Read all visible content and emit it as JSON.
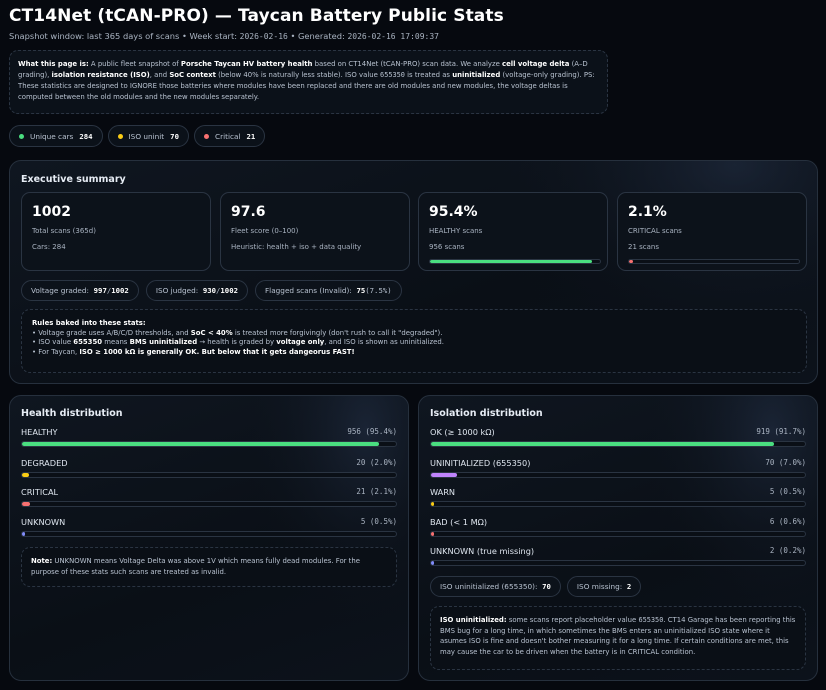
{
  "header": {
    "title": "CT14Net (tCAN-PRO) — Taycan Battery Public Stats",
    "snapshot_prefix": "Snapshot window: last 365 days of scans • Week start: ",
    "week_start": "2026-02-16",
    "generated_prefix": " • Generated: ",
    "generated": "2026-02-16 17:09:37"
  },
  "about": {
    "lead": "What this page is:",
    "t1": " A public fleet snapshot of ",
    "b1": "Porsche Taycan HV battery health",
    "t2": " based on CT14Net (tCAN-PRO) scan data. We analyze ",
    "b2": "cell voltage delta",
    "t3": " (A–D grading), ",
    "b3": "isolation resistance (ISO)",
    "t4": ", and ",
    "b4": "SoC context",
    "t5": " (below 40% is naturally less stable). ISO value ",
    "c1": "655350",
    "t6": " is treated as ",
    "b5": "uninitialized",
    "t7": " (voltage-only grading). PS: These statistics are designed to IGNORE those batteries where modules have been replaced and there are old modules and new modules, the voltage deltas is computed between the old modules and the new modules separately."
  },
  "top_pills": [
    {
      "label": "Unique cars",
      "value": "284",
      "color": "#4ade80"
    },
    {
      "label": "ISO uninit",
      "value": "70",
      "color": "#facc15"
    },
    {
      "label": "Critical",
      "value": "21",
      "color": "#f87171"
    }
  ],
  "exec": {
    "title": "Executive summary",
    "stats": [
      {
        "big": "1002",
        "label": "Total scans (365d)",
        "sub": "Cars: 284"
      },
      {
        "big": "97.6",
        "label": "Fleet score (0–100)",
        "sub": "Heuristic: health + iso + data quality"
      },
      {
        "big": "95.4%",
        "label": "HEALTHY scans",
        "sub": "956 scans",
        "fill": 0.954,
        "color": "#4ade80"
      },
      {
        "big": "2.1%",
        "label": "CRITICAL scans",
        "sub": "21 scans",
        "fill": 0.021,
        "color": "#f87171"
      }
    ],
    "meta": [
      {
        "label": "Voltage graded:",
        "a": "997",
        "sep": " / ",
        "b": "1002"
      },
      {
        "label": "ISO judged:",
        "a": "930",
        "sep": " / ",
        "b": "1002"
      },
      {
        "label": "Flagged scans (Invalid):",
        "a": "75",
        "sep": " ",
        "b": "(7.5%)"
      }
    ],
    "rules": {
      "head": "Rules baked into these stats:",
      "l1a": "• Voltage grade uses A/B/C/D thresholds, and ",
      "l1b": "SoC < 40%",
      "l1c": " is treated more forgivingly (don't rush to call it \"degraded\").",
      "l2a": "• ISO value ",
      "l2b": "655350",
      "l2c": " means ",
      "l2d": "BMS uninitialized",
      "l2e": " → health is graded by ",
      "l2f": "voltage only",
      "l2g": ", and ISO is shown as uninitialized.",
      "l3a": "• For Taycan, ",
      "l3b": "ISO ≥ 1000 kΩ is generally OK. But below that it gets dangeorus FAST!",
      "l3c": ""
    }
  },
  "health": {
    "title": "Health distribution",
    "rows": [
      {
        "label": "HEALTHY",
        "value": "956 (95.4%)",
        "fill": 0.954,
        "color": "#4ade80"
      },
      {
        "label": "DEGRADED",
        "value": "20 (2.0%)",
        "fill": 0.02,
        "color": "#facc15"
      },
      {
        "label": "CRITICAL",
        "value": "21 (2.1%)",
        "fill": 0.021,
        "color": "#f87171"
      },
      {
        "label": "UNKNOWN",
        "value": "5 (0.5%)",
        "fill": 0.005,
        "color": "#818cf8"
      }
    ],
    "note_head": "Note:",
    "note": " UNKNOWN means Voltage Delta was above 1V which means fully dead modules. For the purpose of these stats such scans are treated as invalid."
  },
  "iso": {
    "title": "Isolation distribution",
    "rows": [
      {
        "label": "OK (≥ 1000 kΩ)",
        "value": "919 (91.7%)",
        "fill": 0.917,
        "color": "#4ade80"
      },
      {
        "label": "UNINITIALIZED (655350)",
        "value": "70 (7.0%)",
        "fill": 0.07,
        "color": "#c084fc"
      },
      {
        "label": "WARN",
        "value": "5 (0.5%)",
        "fill": 0.005,
        "color": "#facc15"
      },
      {
        "label": "BAD (< 1 MΩ)",
        "value": "6 (0.6%)",
        "fill": 0.006,
        "color": "#f87171"
      },
      {
        "label": "UNKNOWN (true missing)",
        "value": "2 (0.2%)",
        "fill": 0.002,
        "color": "#818cf8"
      }
    ],
    "pills": [
      {
        "label": "ISO uninitialized (655350):",
        "value": "70"
      },
      {
        "label": "ISO missing:",
        "value": "2"
      }
    ],
    "note_head": "ISO uninitialized:",
    "note_a": " some scans report placeholder value ",
    "note_code": "655350",
    "note_b": ". CT14 Garage has been reporting this BMS bug for a long time, in which sometimes the BMS enters an uninitialized ISO state where it asumes ISO is fine and doesn't bother measuring it for a long time. If certain conditions are met, this may cause the car to be driven when the battery is in CRITICAL condition."
  }
}
